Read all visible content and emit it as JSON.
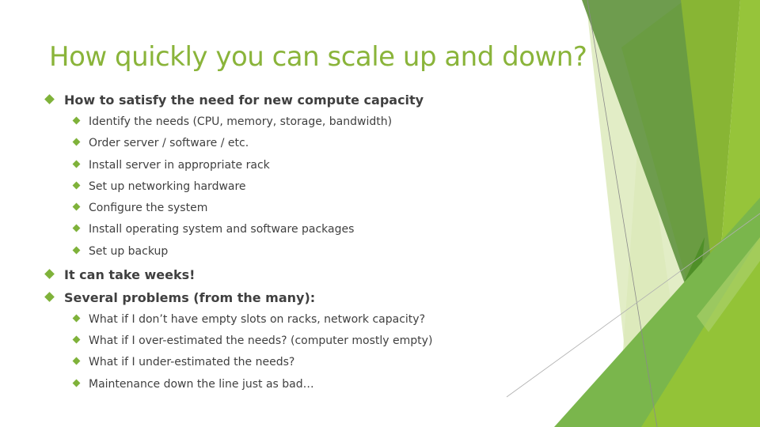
{
  "slide": {
    "title": "How quickly you can scale up and down?",
    "bullets": [
      {
        "text": "How to satisfy the need for new compute capacity",
        "sub": [
          "Identify the needs (CPU, memory, storage, bandwidth)",
          "Order server / software / etc.",
          "Install server in appropriate rack",
          "Set up networking hardware",
          "Configure the system",
          "Install operating system and software packages",
          "Set up backup"
        ]
      },
      {
        "text": "It can take weeks!",
        "sub": []
      },
      {
        "text": "Several problems (from the many):",
        "sub": [
          "What if I don’t have empty slots on racks, network capacity?",
          "What if I over-estimated the needs? (computer mostly empty)",
          "What if I under-estimated the needs?",
          "Maintenance down the line just as bad…"
        ]
      }
    ]
  },
  "theme": {
    "accent": "#8ab43a",
    "bullet": "#7fb23a",
    "text": "#404040"
  }
}
